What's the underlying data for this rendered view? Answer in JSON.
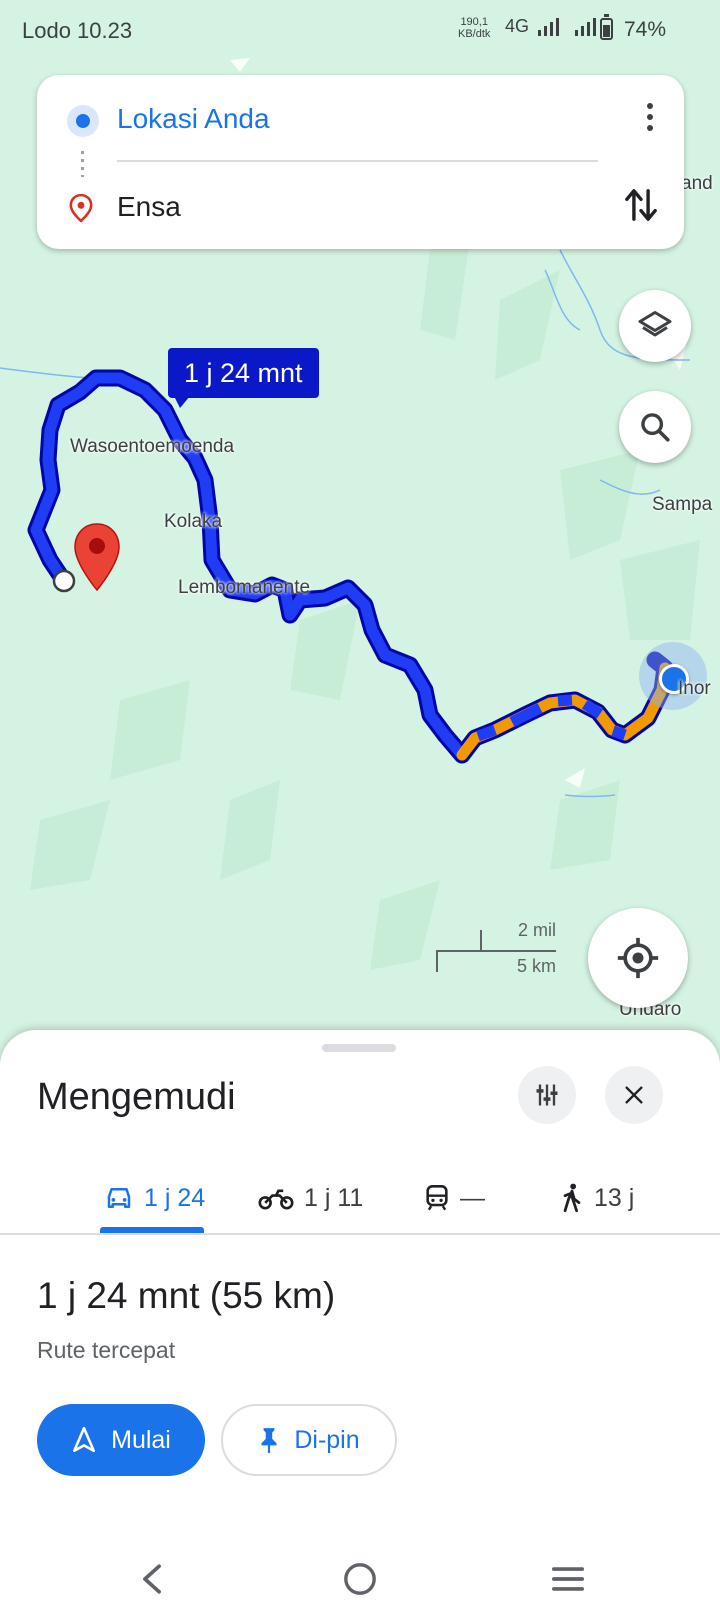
{
  "status_bar": {
    "time": "Lodo 10.23",
    "net_speed_line1": "190,1",
    "net_speed_line2": "KB/dtk",
    "network": "4G",
    "battery": "74%"
  },
  "search": {
    "origin": "Lokasi Anda",
    "destination": "Ensa"
  },
  "map": {
    "duration_bubble": "1 j 24 mnt",
    "places": {
      "p1": "Wasoentoemoenda",
      "p2": "Kolaka",
      "p3": "Lembomanente",
      "p4": "Sampa",
      "p5": "and",
      "p6": "Inor",
      "p7": "Undaro"
    },
    "scale_mi": "2 mil",
    "scale_km": "5 km",
    "route_color": "#0b18c8",
    "traffic_color": "#f29900"
  },
  "sheet": {
    "title": "Mengemudi",
    "tabs": {
      "car": "1 j 24",
      "motorbike": "1 j 11",
      "transit": "—",
      "walk": "13 j"
    },
    "route_time": "1 j 24 mnt (55 km)",
    "route_desc": "Rute tercepat",
    "start_label": "Mulai",
    "pin_label": "Di-pin"
  }
}
